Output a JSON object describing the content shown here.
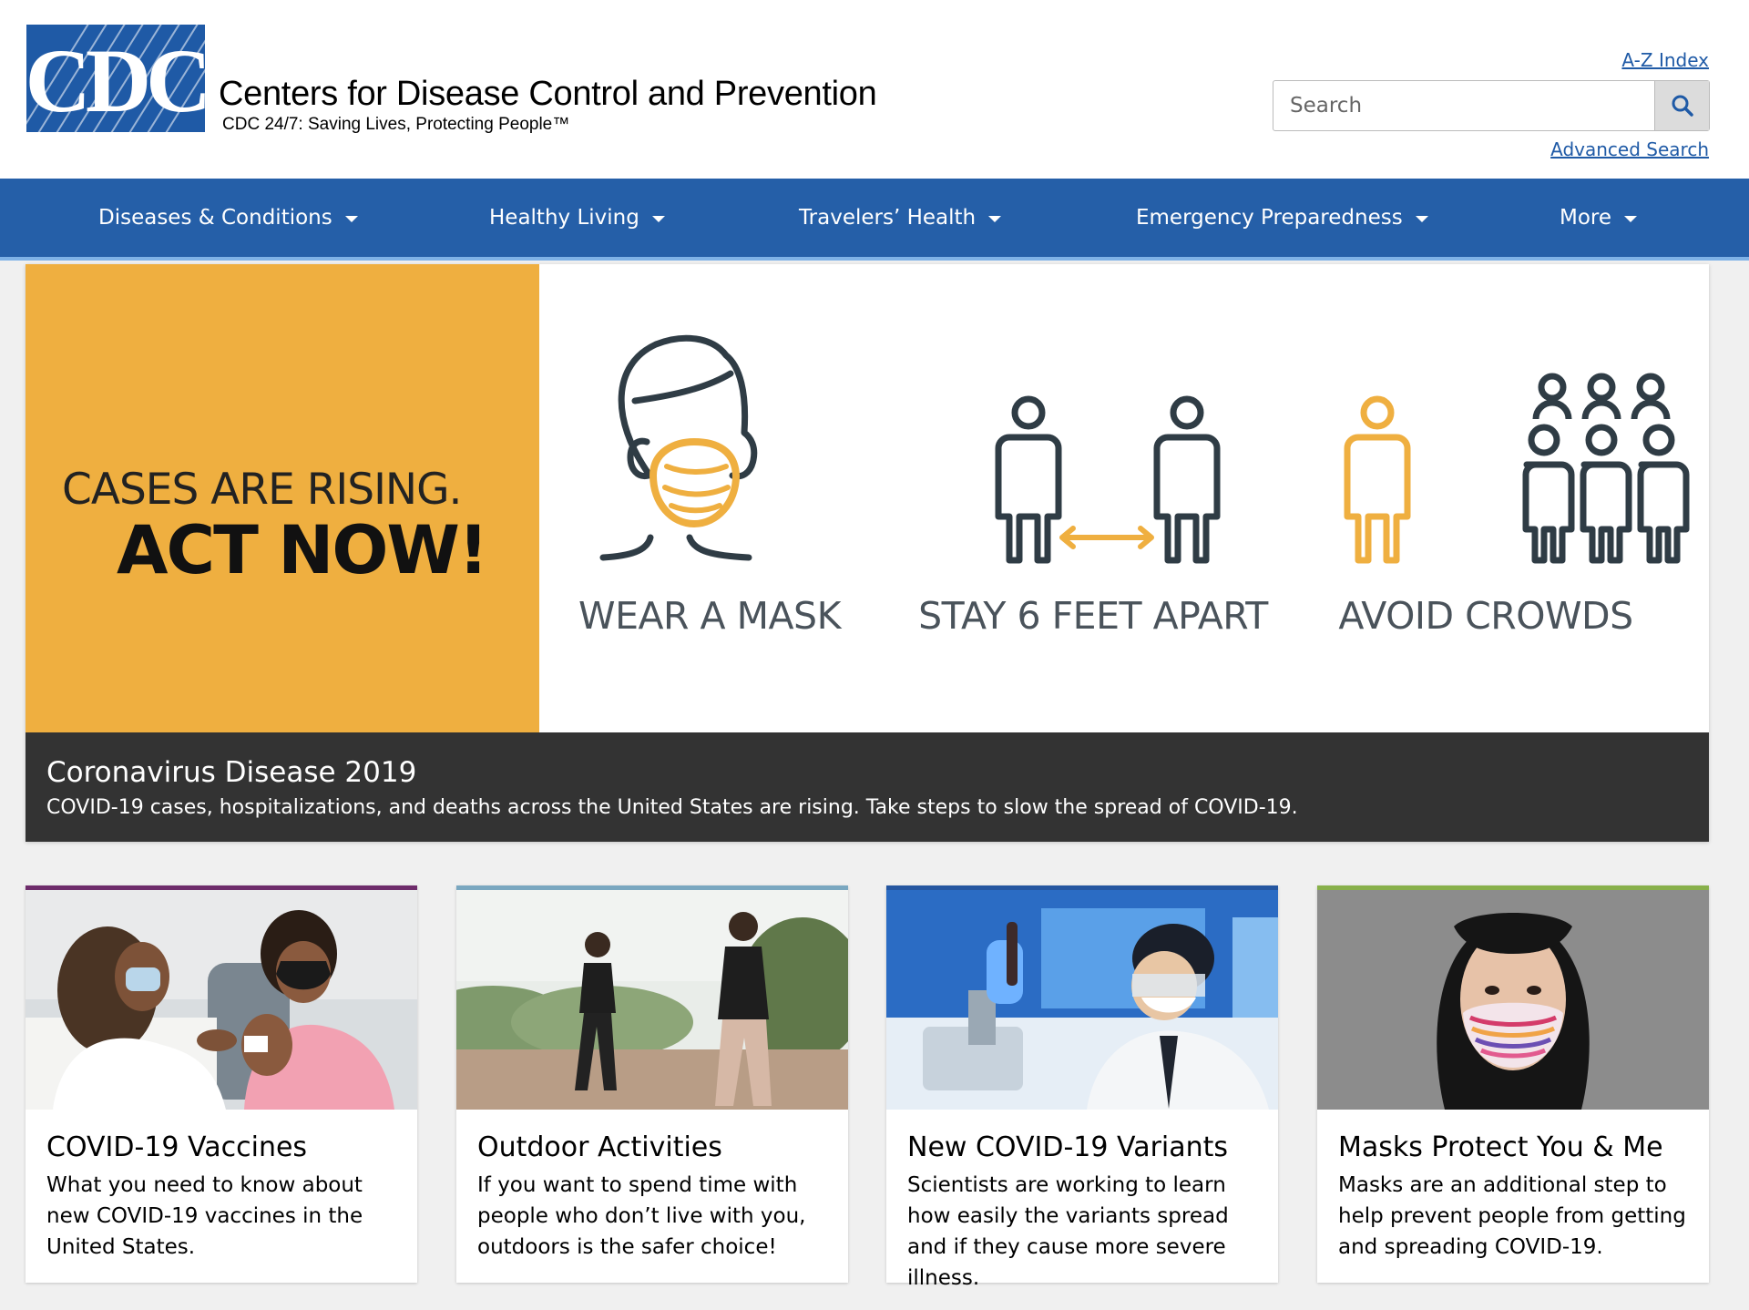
{
  "header": {
    "logo_text": "CDC",
    "org_name": "Centers for Disease Control and Prevention",
    "tagline": "CDC 24/7: Saving Lives, Protecting People™",
    "az_index": "A-Z Index",
    "search_placeholder": "Search",
    "advanced_search": "Advanced Search"
  },
  "nav": {
    "items": [
      {
        "label": "Diseases & Conditions"
      },
      {
        "label": "Healthy Living"
      },
      {
        "label": "Travelers’ Health"
      },
      {
        "label": "Emergency Preparedness"
      },
      {
        "label": "More"
      }
    ]
  },
  "hero": {
    "line1": "CASES ARE RISING.",
    "line2": "ACT NOW!",
    "steps": [
      {
        "label": "WEAR A MASK",
        "icon": "face-mask-icon"
      },
      {
        "label": "STAY 6 FEET APART",
        "icon": "social-distance-icon"
      },
      {
        "label": "AVOID CROWDS",
        "icon": "crowd-icon"
      }
    ],
    "caption_title": "Coronavirus Disease 2019",
    "caption_desc": "COVID-19 cases, hospitalizations, and deaths across the United States are rising. Take steps to slow the spread of COVID-19."
  },
  "cards": [
    {
      "title": "COVID-19 Vaccines",
      "desc": "What you need to know about new COVID-19 vaccines in the United States.",
      "accent": "#6e2c6b"
    },
    {
      "title": "Outdoor Activities",
      "desc": "If you want to spend time with people who don’t live with you, outdoors is the safer choice!",
      "accent": "#7aa7c0"
    },
    {
      "title": "New COVID-19 Variants",
      "desc": "Scientists are working to learn how easily the variants spread and if they cause more severe illness.",
      "accent": "#2556a0"
    },
    {
      "title": "Masks Protect You & Me",
      "desc": "Masks are an additional step to help prevent people from getting and spreading COVID-19.",
      "accent": "#88b04b"
    }
  ],
  "colors": {
    "brand_blue": "#255fa8",
    "hero_yellow": "#efaf40",
    "caption_bg": "#333333"
  }
}
